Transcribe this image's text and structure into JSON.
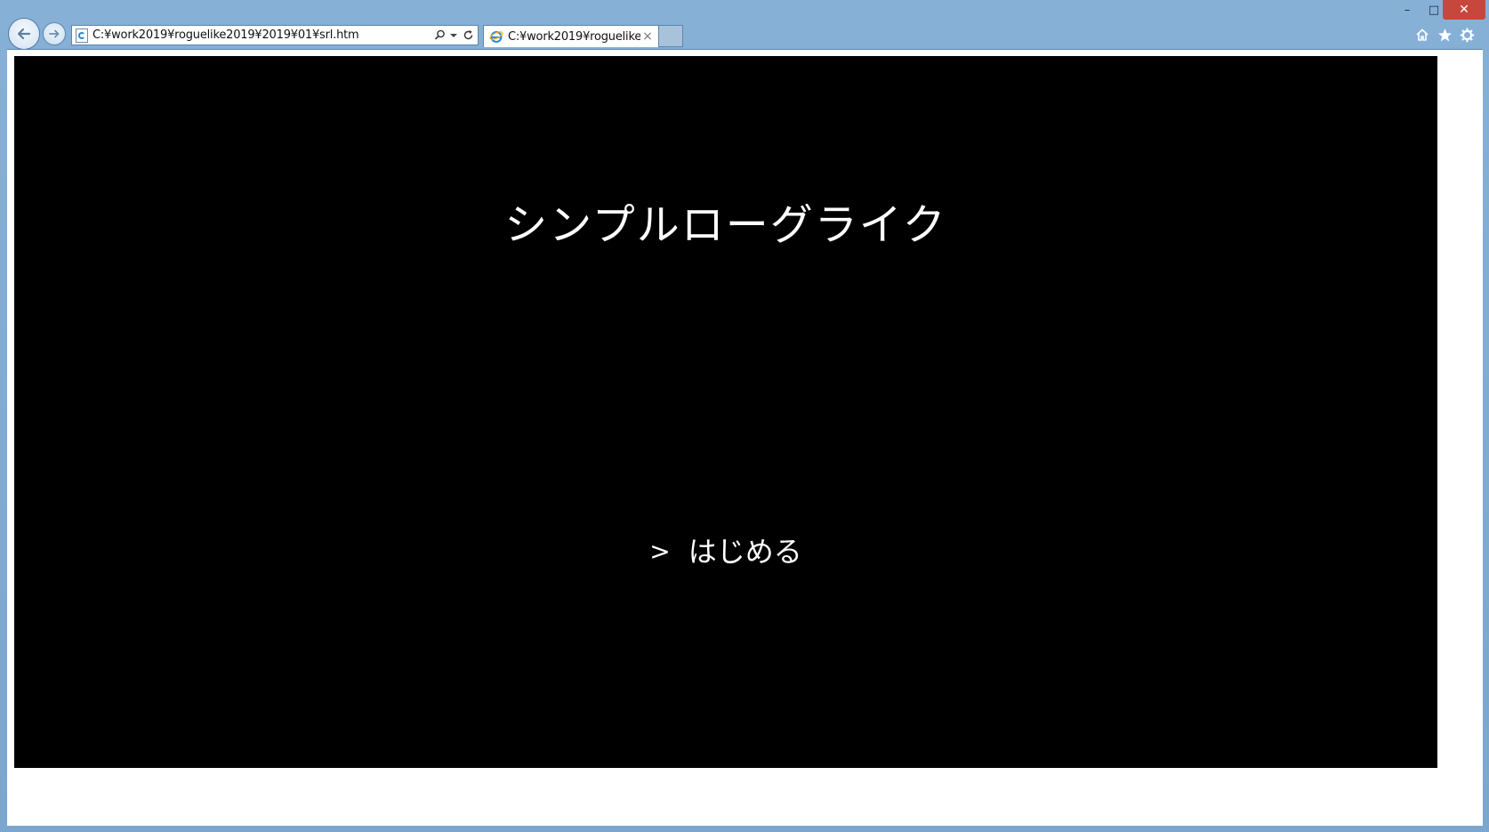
{
  "window": {
    "minimize_glyph": "–",
    "maximize_glyph": "□",
    "close_glyph": "✕"
  },
  "browser": {
    "address_url": "C:¥work2019¥roguelike2019¥2019¥01¥srl.htm",
    "tab_title": "C:¥work2019¥roguelike...",
    "tab_close_glyph": "×",
    "icons": [
      "back-arrow-icon",
      "forward-arrow-icon",
      "page-favicon",
      "search-icon",
      "dropdown-icon",
      "refresh-icon",
      "ie-favicon",
      "home-icon",
      "star-icon",
      "gear-icon"
    ]
  },
  "game": {
    "title": "シンプルローグライク",
    "menu_cursor": ">",
    "start_label": "はじめる"
  },
  "colors": {
    "frame": "#7ba7cf",
    "canvas": "#000000",
    "text": "#ffffff",
    "close_button": "#c7473c"
  }
}
